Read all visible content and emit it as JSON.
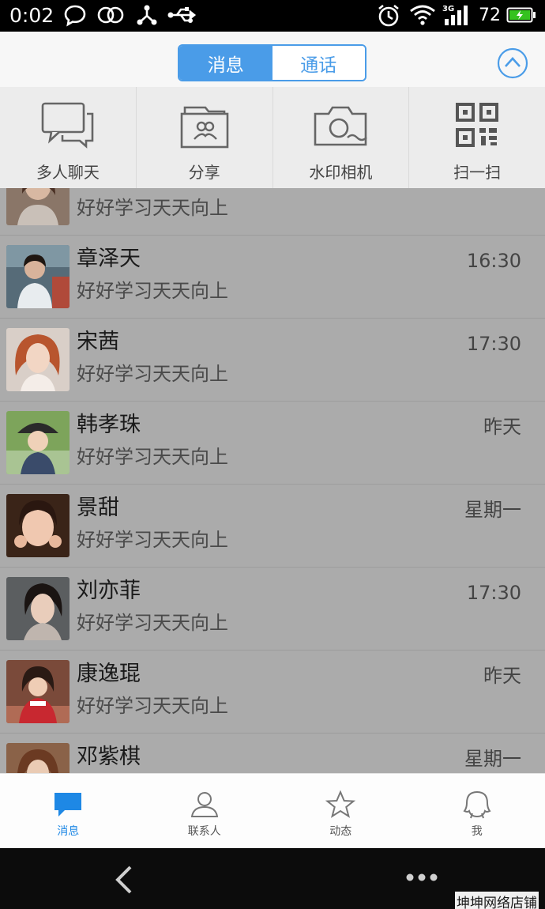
{
  "status_bar": {
    "time": "0:02",
    "network_label": "3G",
    "battery_percent": "72"
  },
  "header": {
    "tabs": [
      {
        "label": "消息",
        "active": true
      },
      {
        "label": "通话",
        "active": false
      }
    ],
    "collapse_icon": "chevron-up-circle-icon"
  },
  "quick_actions": [
    {
      "label": "多人聊天",
      "icon": "group-chat-icon"
    },
    {
      "label": "分享",
      "icon": "share-icon"
    },
    {
      "label": "水印相机",
      "icon": "camera-icon"
    },
    {
      "label": "扫一扫",
      "icon": "qr-scan-icon"
    }
  ],
  "conversations": [
    {
      "name": "",
      "message": "好好学习天天向上",
      "time": ""
    },
    {
      "name": "章泽天",
      "message": "好好学习天天向上",
      "time": "16:30"
    },
    {
      "name": "宋茜",
      "message": "好好学习天天向上",
      "time": "17:30"
    },
    {
      "name": "韩孝珠",
      "message": "好好学习天天向上",
      "time": "昨天"
    },
    {
      "name": "景甜",
      "message": "好好学习天天向上",
      "time": "星期一"
    },
    {
      "name": "刘亦菲",
      "message": "好好学习天天向上",
      "time": "17:30"
    },
    {
      "name": "康逸琨",
      "message": "好好学习天天向上",
      "time": "昨天"
    },
    {
      "name": "邓紫棋",
      "message": "",
      "time": "星期一"
    }
  ],
  "tab_bar": [
    {
      "label": "消息",
      "icon": "message-icon",
      "active": true
    },
    {
      "label": "联系人",
      "icon": "contacts-icon",
      "active": false
    },
    {
      "label": "动态",
      "icon": "star-icon",
      "active": false
    },
    {
      "label": "我",
      "icon": "penguin-icon",
      "active": false
    }
  ],
  "colors": {
    "accent": "#4a9ce8",
    "overlay": "#ababab"
  },
  "watermark": "坤坤网络店铺"
}
